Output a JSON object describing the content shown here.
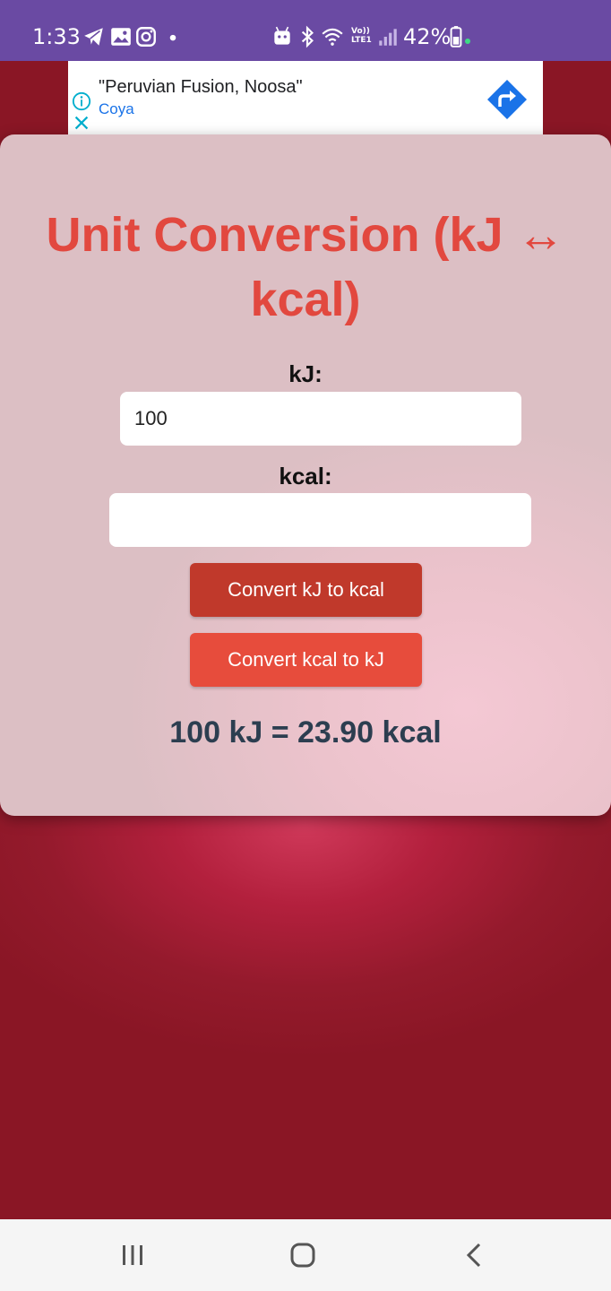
{
  "status_bar": {
    "time": "1:33",
    "battery": "42%",
    "left_icons": [
      "telegram-icon",
      "gallery-icon",
      "instagram-icon",
      "dot-icon"
    ],
    "right_icons": [
      "android-icon",
      "bluetooth-icon",
      "wifi-icon",
      "lte-icon",
      "signal-icon",
      "battery-icon"
    ],
    "lte_label": "Vo)) LTE1",
    "color": "#6a4aa3"
  },
  "ad": {
    "title": "\"Peruvian Fusion, Noosa\"",
    "subtitle": "Coya",
    "accent_color": "#1a73e8"
  },
  "card": {
    "title": "Unit Conversion (kJ ↔ kcal)",
    "title_color": "#e2483f",
    "kj_label": "kJ:",
    "kj_value": "100",
    "kcal_label": "kcal:",
    "kcal_value": "",
    "button_kj_to_kcal": "Convert kJ to kcal",
    "button_kcal_to_kj": "Convert kcal to kJ",
    "button_colors": [
      "#c0392b",
      "#e74c3c"
    ],
    "result": "100 kJ = 23.90 kcal"
  },
  "nav_bar": {
    "icons": [
      "recent-apps-icon",
      "home-icon",
      "back-icon"
    ]
  }
}
